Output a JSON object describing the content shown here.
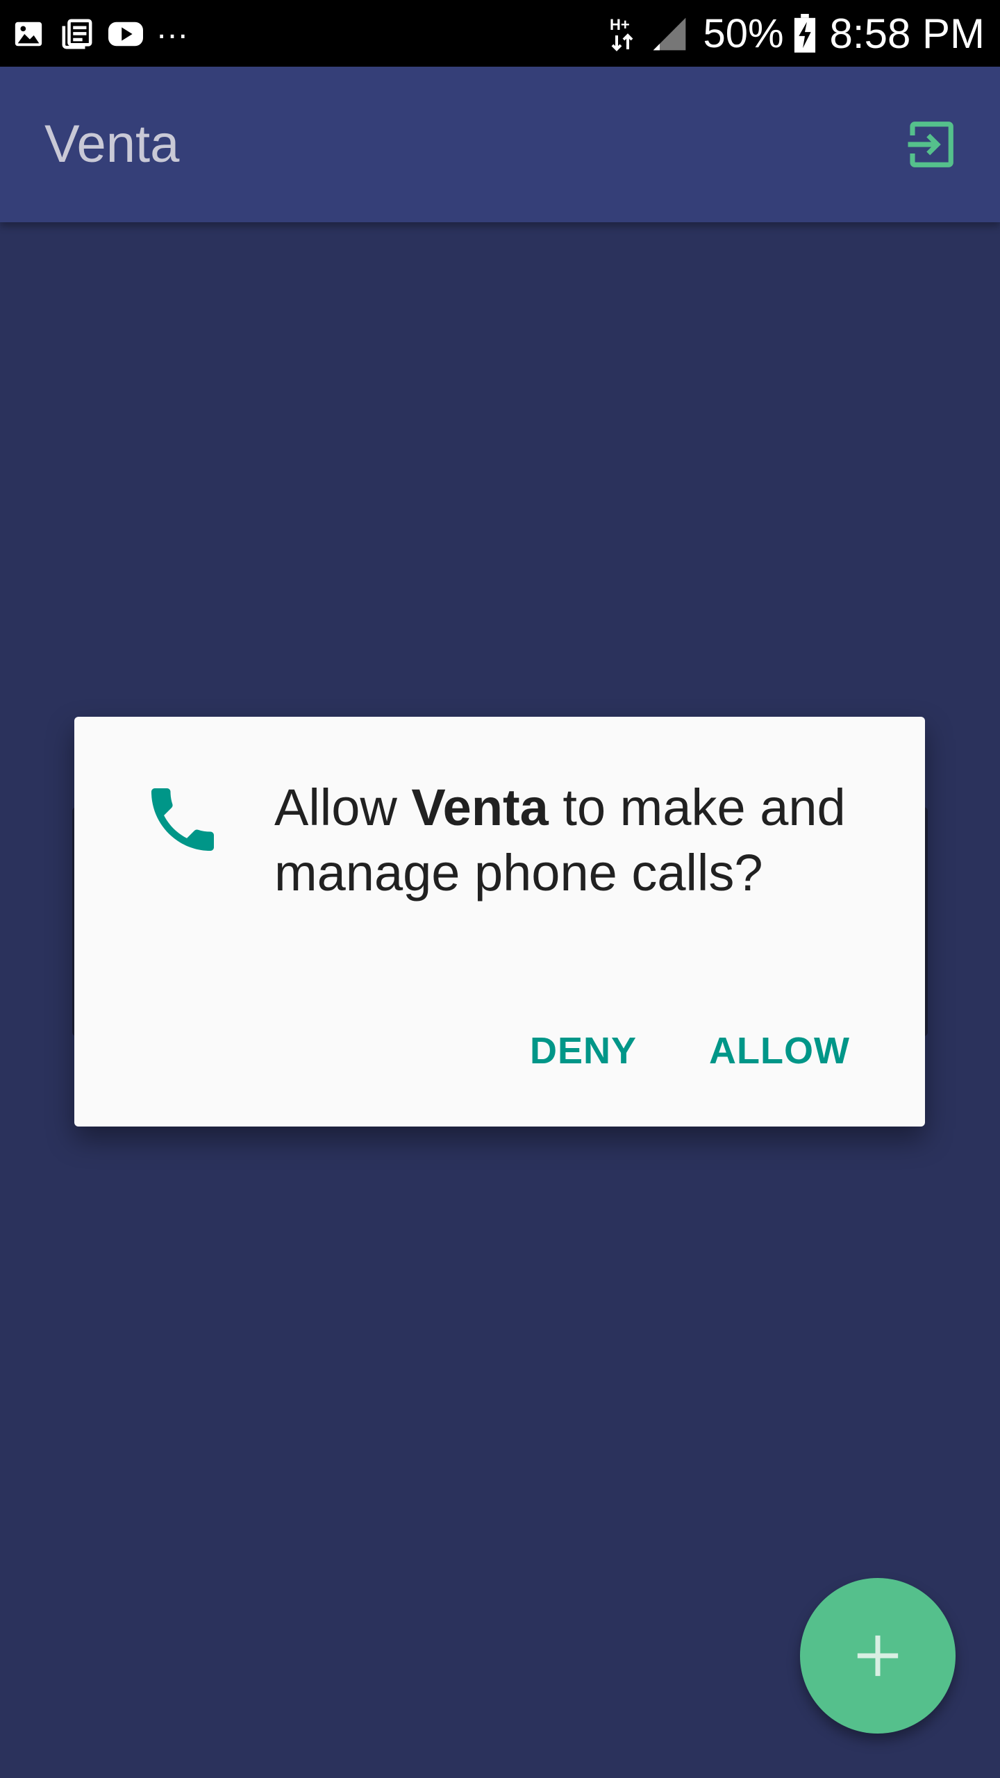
{
  "status_bar": {
    "icons_left": [
      "image-icon",
      "news-icon",
      "youtube-icon"
    ],
    "more": "...",
    "network_type": "H+",
    "battery_percent": "50%",
    "time": "8:58 PM"
  },
  "app_bar": {
    "title": "Venta",
    "action_icon": "exit-to-app-icon",
    "action_color": "#55c08c"
  },
  "dialog": {
    "icon": "phone-icon",
    "icon_color": "#009688",
    "message_prefix": "Allow ",
    "app_name": "Venta",
    "message_suffix": " to make and manage phone calls?",
    "deny_label": "DENY",
    "allow_label": "ALLOW"
  },
  "fab": {
    "icon": "plus-icon",
    "color": "#55c08c"
  },
  "colors": {
    "background": "#2b325c",
    "app_bar": "#353f78",
    "accent": "#009688"
  }
}
